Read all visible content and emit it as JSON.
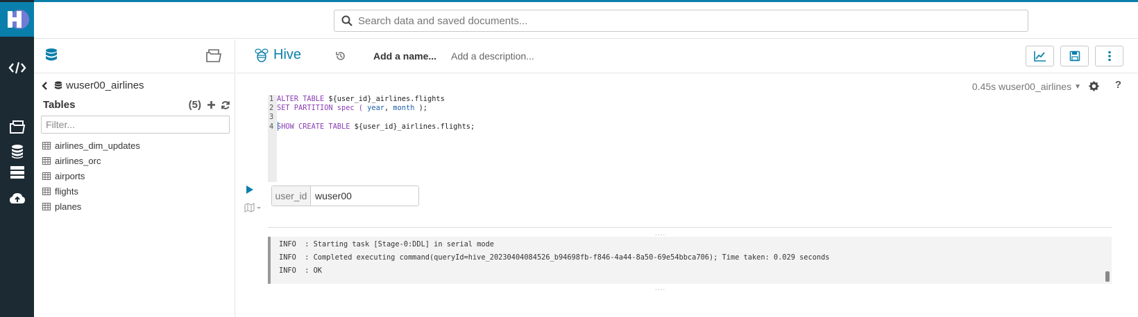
{
  "search": {
    "placeholder": "Search data and saved documents..."
  },
  "assist": {
    "database": "wuser00_airlines",
    "tables_title": "Tables",
    "tables_count": "(5)",
    "filter_placeholder": "Filter...",
    "tables": [
      "airlines_dim_updates",
      "airlines_orc",
      "airports",
      "flights",
      "planes"
    ]
  },
  "editor": {
    "engine": "Hive",
    "add_name": "Add a name...",
    "add_description": "Add a description...",
    "exec_time": "0.45s",
    "active_db": "wuser00_airlines",
    "help": "?",
    "code_lines": [
      {
        "num": "1",
        "tokens": [
          [
            "kw",
            "ALTER TABLE "
          ],
          [
            "id",
            "${user_id}_airlines.flights"
          ]
        ]
      },
      {
        "num": "2",
        "tokens": [
          [
            "kw",
            "SET PARTITION spec ( "
          ],
          [
            "col",
            "year"
          ],
          [
            "id",
            ", "
          ],
          [
            "col",
            "month"
          ],
          [
            "id",
            " );"
          ]
        ]
      },
      {
        "num": "3",
        "tokens": []
      },
      {
        "num": "4",
        "tokens": [
          [
            "kw",
            "SHOW CREATE TABLE "
          ],
          [
            "id",
            "${user_id}_airlines.flights;"
          ]
        ]
      }
    ],
    "param_label": "user_id",
    "param_value": "wuser00"
  },
  "log": [
    "INFO  : Starting task [Stage-0:DDL] in serial mode",
    "INFO  : Completed executing command(queryId=hive_20230404084526_b94698fb-f846-4a44-8a50-69e54bbca706); Time taken: 0.029 seconds",
    "INFO  : OK"
  ],
  "colors": {
    "accent": "#0B7FAB",
    "rail": "#1C2A33",
    "keyword": "#8B3DB5",
    "column": "#1F5FA8"
  }
}
